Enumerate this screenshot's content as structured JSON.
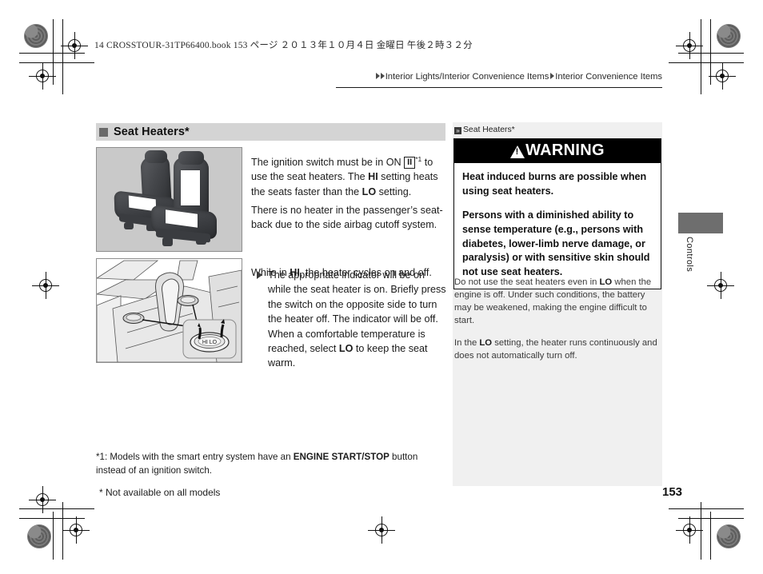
{
  "book_header": "14 CROSSTOUR-31TP66400.book   153 ページ   ２０１３年１０月４日   金曜日   午後２時３２分",
  "breadcrumb": {
    "item1": "Interior Lights/Interior Convenience Items",
    "item2": "Interior Convenience Items"
  },
  "section": {
    "title": "Seat Heaters*"
  },
  "figures": {
    "seats_caption": "front-seats-illustration",
    "console_caption": "center-console-seat-heater-switch-illustration"
  },
  "body": {
    "p1_before": "The ignition switch must be in ON ",
    "p1_key": "II",
    "p1_sup": "*1",
    "p1_after_a": " to use the seat heaters. The ",
    "p1_bold_hi": "HI",
    "p1_after_b": " setting heats the seats faster than the ",
    "p1_bold_lo": "LO",
    "p1_after_c": " setting.",
    "p2": "There is no heater in the passenger’s seat-back due to the side airbag cutoff system.",
    "p3_before": "While in ",
    "p3_bold_hi": "HI",
    "p3_after": ", the heater cycles on and off.",
    "bullet_a": "The appropriate indicator will be on while the seat heater is on. Briefly press the switch on the opposite side to turn the heater off. The indicator will be off. When a comfortable temperature is reached, select ",
    "bullet_bold_lo": "LO",
    "bullet_b": " to keep the seat warm."
  },
  "footnote": {
    "prefix": "*1: Models with the smart entry system have an ",
    "bold": "ENGINE START/STOP",
    "suffix": " button instead of an ignition switch.",
    "availability": "* Not available on all models"
  },
  "right_panel": {
    "label_glyph": "»",
    "label": "Seat Heaters*",
    "warning_title": "WARNING",
    "warning_p1": "Heat induced burns are possible when using seat heaters.",
    "warning_p2": "Persons with a diminished ability to sense temperature (e.g., persons with diabetes, lower-limb nerve damage, or paralysis) or with sensitive skin should not use seat heaters.",
    "note1_a": "Do not use the seat heaters even in ",
    "note1_bold": "LO",
    "note1_b": " when the engine is off. Under such conditions, the battery may be weakened, making the engine difficult to start.",
    "note2_a": "In the ",
    "note2_bold": "LO",
    "note2_b": " setting, the heater runs continuously and does not automatically turn off."
  },
  "side_tab": {
    "label": "Controls"
  },
  "page_number": "153",
  "colors": {
    "heading_band": "#d4d4d4",
    "panel_bg": "#f0f0f0",
    "warning_bar": "#000000",
    "tab_gray": "#6e6e6e"
  }
}
